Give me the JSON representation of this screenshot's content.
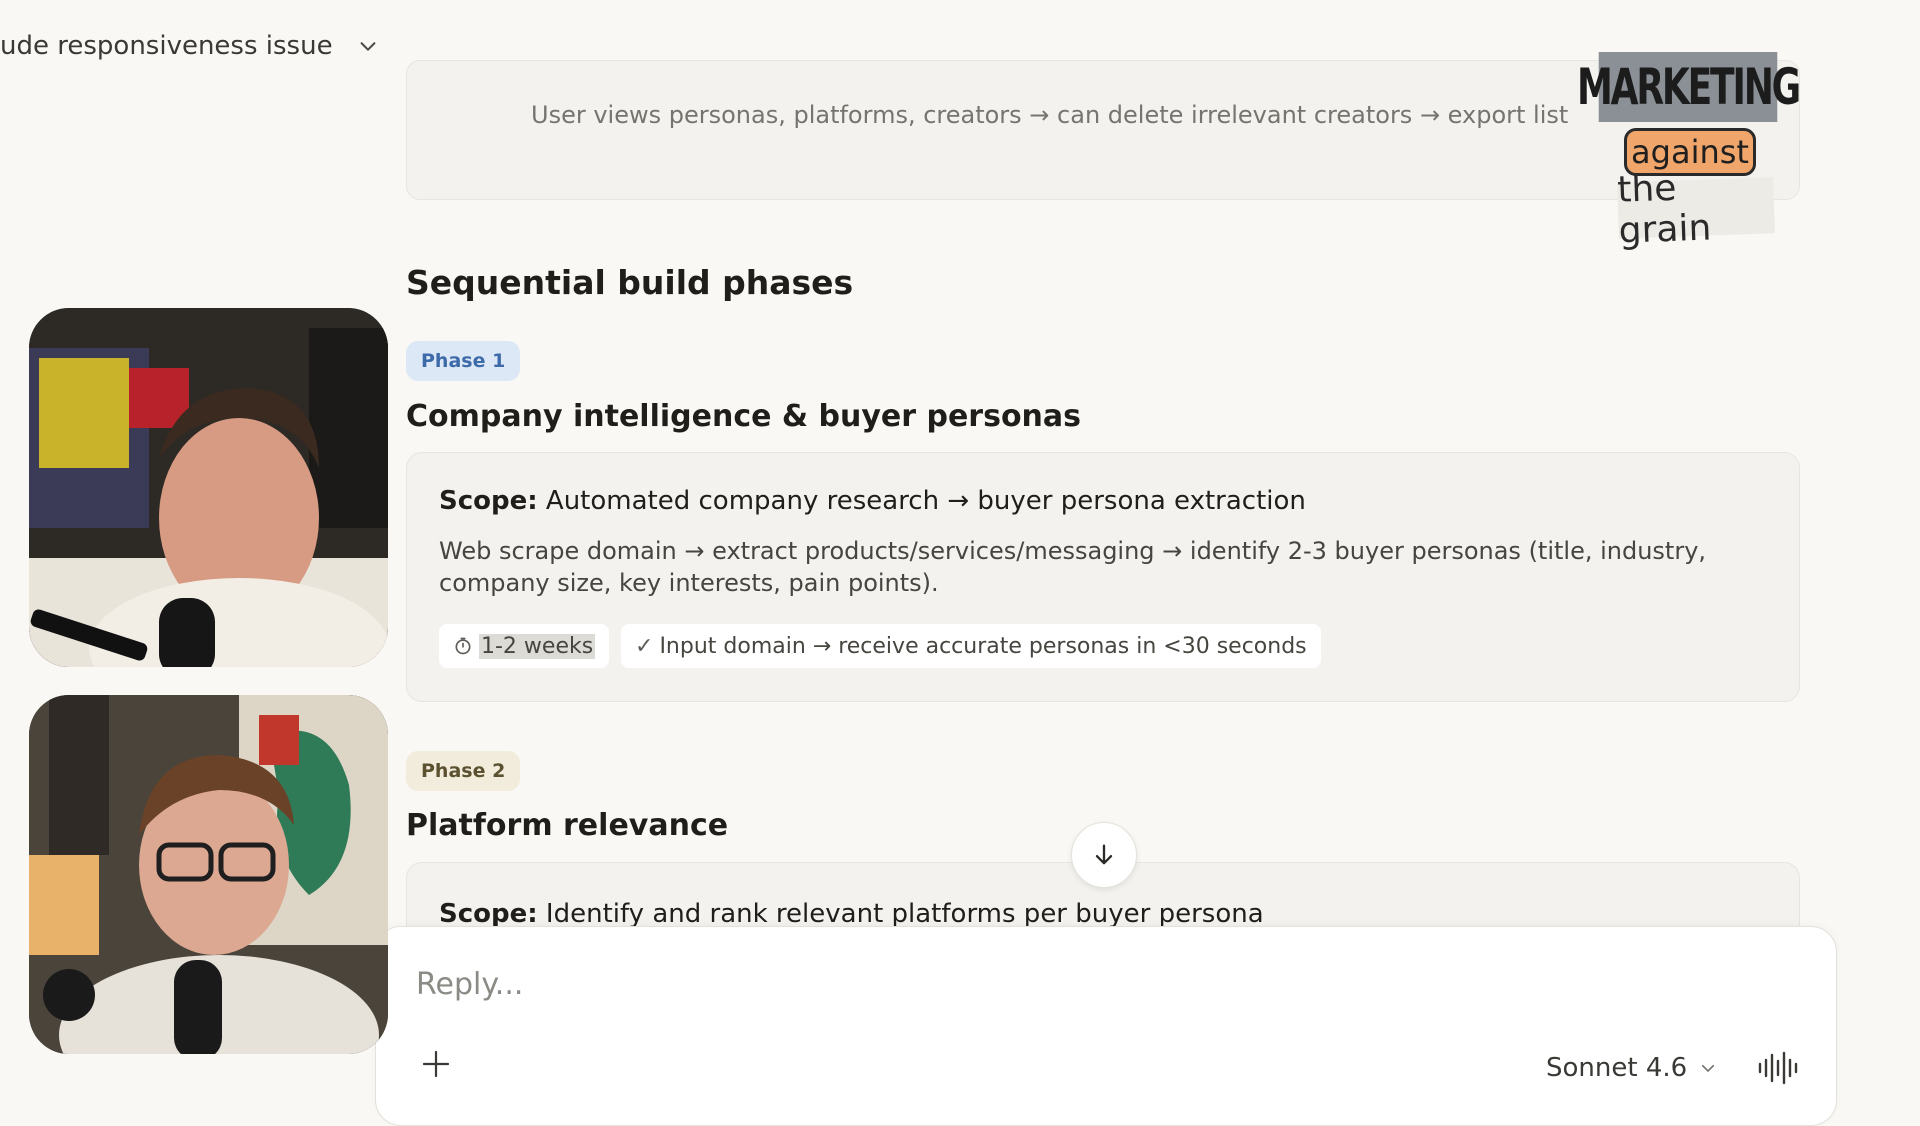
{
  "header": {
    "chat_title": "ude responsiveness issue",
    "title_menu_icon": "chevron-down-icon"
  },
  "top_card": {
    "flow_text": "User views personas, platforms, creators → can delete irrelevant creators → export list"
  },
  "section": {
    "heading": "Sequential build phases"
  },
  "phases": [
    {
      "badge": "Phase 1",
      "title": "Company intelligence & buyer personas",
      "scope_label": "Scope:",
      "scope_text": "Automated company research → buyer persona extraction",
      "description": "Web scrape domain → extract products/services/messaging → identify 2-3 buyer personas (title, industry, company size, key interests, pain points).",
      "timeline": "1-2 weeks",
      "timeline_icon": "timer-icon",
      "success_check": "✓",
      "success_text": "Input domain → receive accurate personas in <30 seconds",
      "badge_color": "#dde8f6",
      "badge_text_color": "#3d6aa8"
    },
    {
      "badge": "Phase 2",
      "title": "Platform relevance",
      "scope_label": "Scope:",
      "scope_text": "Identify and rank relevant platforms per buyer persona",
      "badge_color": "#f1ecdc",
      "badge_text_color": "#5b5130"
    }
  ],
  "composer": {
    "placeholder": "Reply...",
    "model": "Sonnet 4.6",
    "add_icon": "plus-icon",
    "model_menu_icon": "chevron-down-icon",
    "voice_icon": "voice-waveform-icon"
  },
  "scroll_button": {
    "icon": "arrow-down-icon"
  },
  "watermark": {
    "line1": "MARKETING",
    "line2": "against",
    "line3": "the grain",
    "accent": "#f0a56b"
  },
  "videos": [
    {
      "label": "participant-1-video"
    },
    {
      "label": "participant-2-video"
    }
  ]
}
